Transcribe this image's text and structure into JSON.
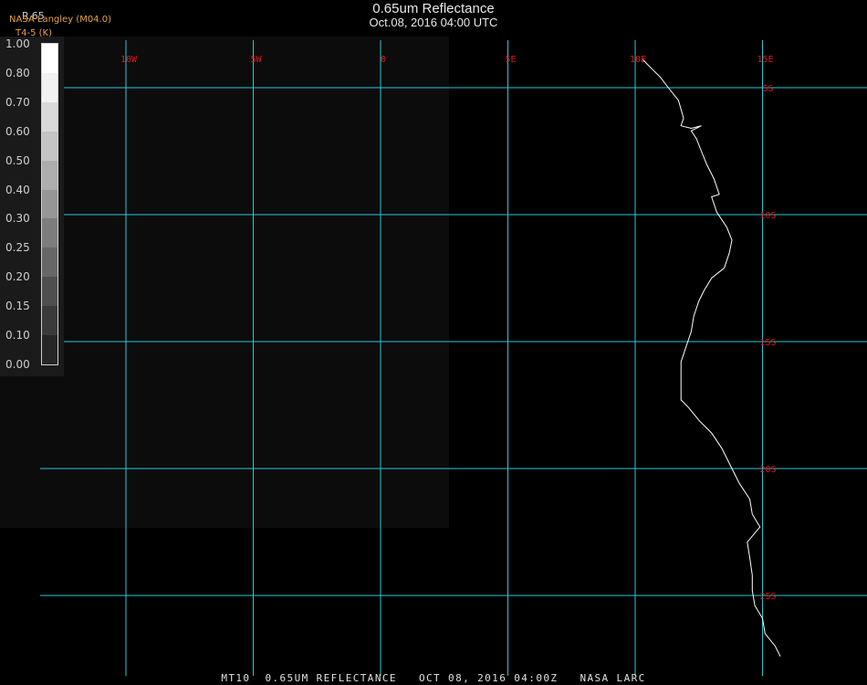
{
  "title": {
    "main": "0.65um Reflectance",
    "sub": "Oct.08, 2016 04:00 UTC"
  },
  "credits": {
    "line1": "NASA Langley (M04.0)",
    "line2": "T4-5 (K)"
  },
  "legend": {
    "title": "R.65",
    "ticks": [
      "1.00",
      "0.80",
      "0.70",
      "0.60",
      "0.50",
      "0.40",
      "0.30",
      "0.25",
      "0.20",
      "0.15",
      "0.10",
      "0.00"
    ],
    "swatch_colors": [
      "#ffffff",
      "#f2f2f2",
      "#d9d9d9",
      "#c4c4c4",
      "#adadad",
      "#969696",
      "#7d7d7d",
      "#676767",
      "#4f4f4f",
      "#3a3a3a",
      "#262626"
    ]
  },
  "map": {
    "projection": "equidistant lat/lon",
    "longitude_labels": [
      "10W",
      "5W",
      "0",
      "5E",
      "10E",
      "15E"
    ],
    "longitudes_deg": [
      -10,
      -5,
      0,
      5,
      10,
      15
    ],
    "latitude_labels": [
      "5S",
      "10S",
      "15S",
      "20S",
      "25S"
    ],
    "latitudes_deg": [
      -5,
      -10,
      -15,
      -20,
      -25
    ],
    "grid_color": "#29c9d6",
    "label_color": "#e01818",
    "coastline_color": "#ffffff",
    "background_color": "#000000",
    "coastline_lonlat": [
      [
        10.3,
        -3.9
      ],
      [
        10.6,
        -4.2
      ],
      [
        11.0,
        -4.6
      ],
      [
        11.3,
        -5.0
      ],
      [
        11.7,
        -5.5
      ],
      [
        11.9,
        -6.2
      ],
      [
        11.8,
        -6.5
      ],
      [
        12.2,
        -6.6
      ],
      [
        12.6,
        -6.5
      ],
      [
        12.2,
        -6.7
      ],
      [
        12.4,
        -7.0
      ],
      [
        12.6,
        -7.5
      ],
      [
        12.8,
        -8.0
      ],
      [
        13.1,
        -8.6
      ],
      [
        13.3,
        -9.2
      ],
      [
        13.0,
        -9.3
      ],
      [
        13.2,
        -9.9
      ],
      [
        13.6,
        -10.5
      ],
      [
        13.8,
        -11.0
      ],
      [
        13.7,
        -11.5
      ],
      [
        13.5,
        -12.1
      ],
      [
        13.0,
        -12.5
      ],
      [
        12.7,
        -13.0
      ],
      [
        12.5,
        -13.4
      ],
      [
        12.3,
        -14.0
      ],
      [
        12.2,
        -14.6
      ],
      [
        12.0,
        -15.2
      ],
      [
        11.8,
        -15.8
      ],
      [
        11.8,
        -16.5
      ],
      [
        11.8,
        -17.3
      ],
      [
        12.1,
        -17.6
      ],
      [
        12.5,
        -18.1
      ],
      [
        13.0,
        -18.6
      ],
      [
        13.4,
        -19.2
      ],
      [
        13.8,
        -20.0
      ],
      [
        14.1,
        -20.6
      ],
      [
        14.5,
        -21.2
      ],
      [
        14.6,
        -21.8
      ],
      [
        14.9,
        -22.3
      ],
      [
        14.4,
        -22.9
      ],
      [
        14.5,
        -23.5
      ],
      [
        14.6,
        -24.2
      ],
      [
        14.6,
        -24.8
      ],
      [
        14.7,
        -25.4
      ],
      [
        15.0,
        -25.9
      ],
      [
        15.1,
        -26.5
      ],
      [
        15.5,
        -27.0
      ],
      [
        15.7,
        -27.4
      ]
    ]
  },
  "footer": {
    "text": "MT10  0.65UM REFLECTANCE   OCT 08, 2016 04:00Z   NASA LARC"
  }
}
